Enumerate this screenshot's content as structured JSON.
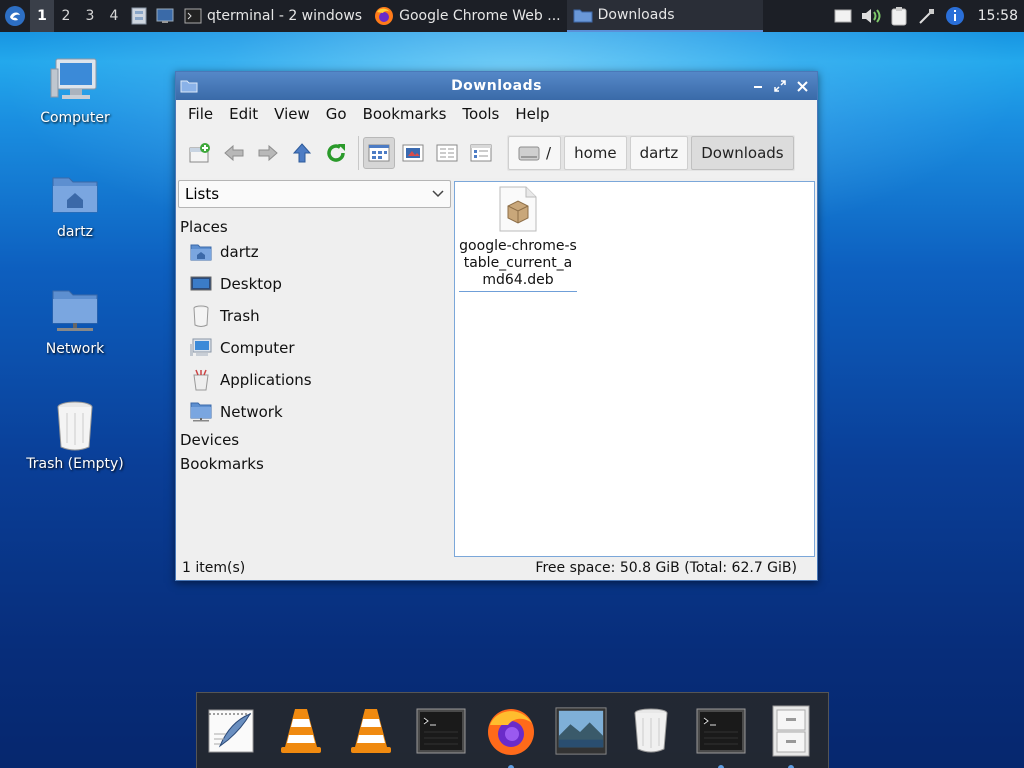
{
  "panel": {
    "desktops": [
      "1",
      "2",
      "3",
      "4"
    ],
    "active_desktop": "1",
    "tasks": [
      {
        "label": "qterminal - 2 windows",
        "icon": "terminal-icon"
      },
      {
        "label": "Google Chrome Web ...",
        "icon": "firefox-icon"
      },
      {
        "label": "Downloads",
        "icon": "folder-icon"
      }
    ],
    "clock": "15:58"
  },
  "desktop_icons": [
    {
      "label": "Computer",
      "icon": "computer-icon"
    },
    {
      "label": "dartz",
      "icon": "home-folder-icon"
    },
    {
      "label": "Network",
      "icon": "network-folder-icon"
    },
    {
      "label": "Trash (Empty)",
      "icon": "trash-icon"
    }
  ],
  "window": {
    "title": "Downloads",
    "menu": [
      "File",
      "Edit",
      "View",
      "Go",
      "Bookmarks",
      "Tools",
      "Help"
    ],
    "breadcrumbs": [
      "/",
      "home",
      "dartz",
      "Downloads"
    ],
    "side_mode": "Lists",
    "sections": {
      "places": "Places",
      "devices": "Devices",
      "bookmarks": "Bookmarks"
    },
    "places": [
      {
        "label": "dartz",
        "icon": "home-folder-icon"
      },
      {
        "label": "Desktop",
        "icon": "desktop-icon"
      },
      {
        "label": "Trash",
        "icon": "trash-icon"
      },
      {
        "label": "Computer",
        "icon": "computer-icon"
      },
      {
        "label": "Applications",
        "icon": "applications-icon"
      },
      {
        "label": "Network",
        "icon": "network-folder-icon"
      }
    ],
    "files": [
      {
        "name": "google-chrome-stable_current_amd64.deb",
        "icon": "package-icon"
      }
    ],
    "status": {
      "count": "1 item(s)",
      "free_space": "Free space: 50.8 GiB (Total: 62.7 GiB)"
    }
  },
  "colors": {
    "accent": "#3c6fb0",
    "panel": "#1c1f26"
  }
}
